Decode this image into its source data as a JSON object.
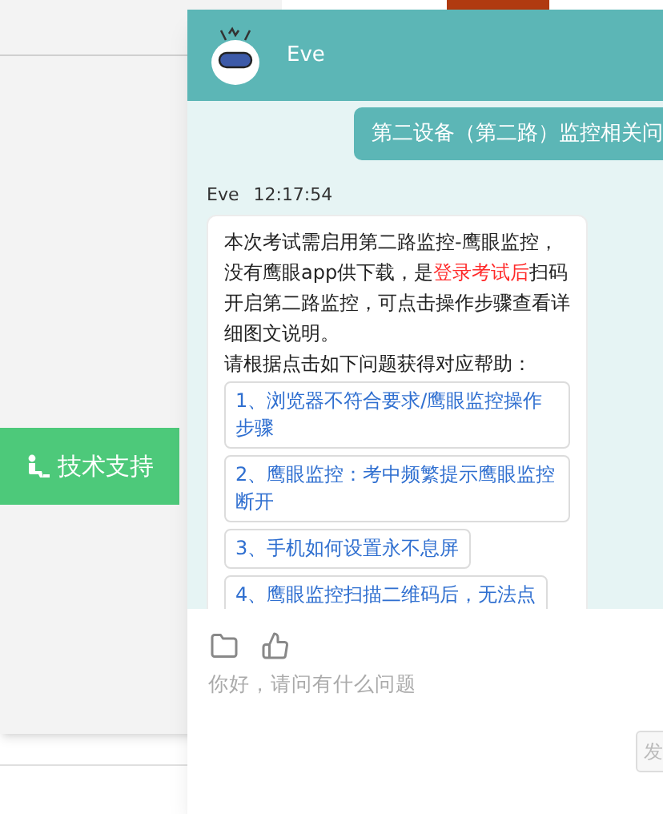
{
  "support_button": {
    "label": "技术支持"
  },
  "chat": {
    "title": "Eve",
    "user_message": "第二设备（第二路）监控相关问",
    "bot_message": {
      "sender": "Eve",
      "time": "12:17:54",
      "paragraphs": [
        [
          {
            "text": "本次考试需启用第二路监控-鹰眼监控，没有鹰眼app供下载，是",
            "highlighted": false
          },
          {
            "text": "登录考试后",
            "highlighted": true
          },
          {
            "text": "扫码开启第二路监控，可点击操作步骤查看详细图文说明。",
            "highlighted": false
          }
        ],
        [
          {
            "text": "请根据点击如下问题获得对应帮助：",
            "highlighted": false
          }
        ]
      ],
      "options": [
        "1、浏览器不符合要求/鹰眼监控操作步骤",
        "2、鹰眼监控：考中频繁提示鹰眼监控断开",
        "3、手机如何设置永不息屏",
        "4、鹰眼监控扫描二维码后，无法点"
      ]
    },
    "input": {
      "placeholder": "你好，请问有什么问题"
    },
    "send_button": "发"
  }
}
